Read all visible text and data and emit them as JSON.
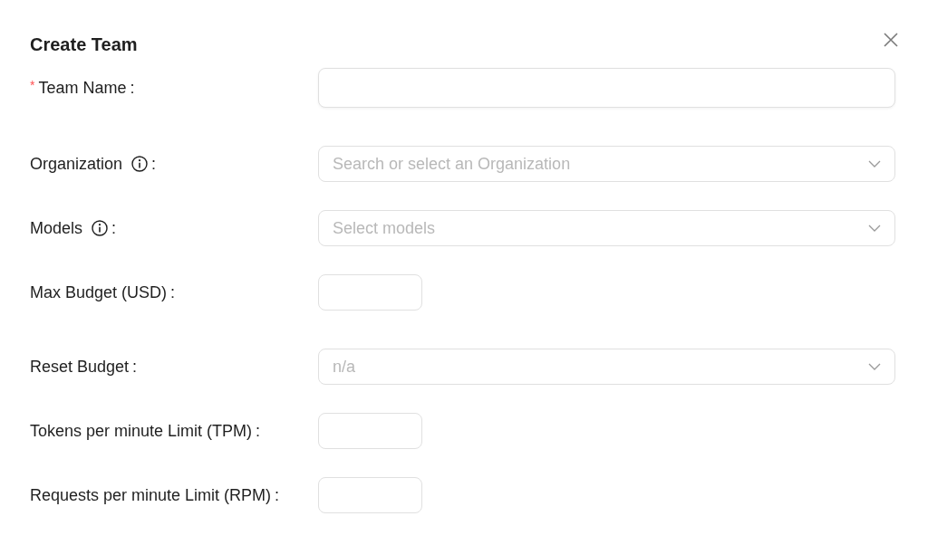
{
  "dialog": {
    "title": "Create Team",
    "required_mark": "*"
  },
  "fields": [
    {
      "label": "Team Name",
      "colon": ":",
      "required": true,
      "info": false,
      "kind": "text"
    },
    {
      "label": "Organization",
      "colon": ":",
      "required": false,
      "info": true,
      "kind": "select",
      "placeholder": "Search or select an Organization"
    },
    {
      "label": "Models",
      "colon": ":",
      "required": false,
      "info": true,
      "kind": "select",
      "placeholder": "Select models"
    },
    {
      "label": "Max Budget (USD)",
      "colon": ":",
      "required": false,
      "info": false,
      "kind": "number"
    },
    {
      "label": "Reset Budget",
      "colon": ":",
      "required": false,
      "info": false,
      "kind": "select",
      "placeholder": "n/a"
    },
    {
      "label": "Tokens per minute Limit (TPM)",
      "colon": ":",
      "required": false,
      "info": false,
      "kind": "number"
    },
    {
      "label": "Requests per minute Limit (RPM)",
      "colon": ":",
      "required": false,
      "info": false,
      "kind": "number"
    }
  ]
}
